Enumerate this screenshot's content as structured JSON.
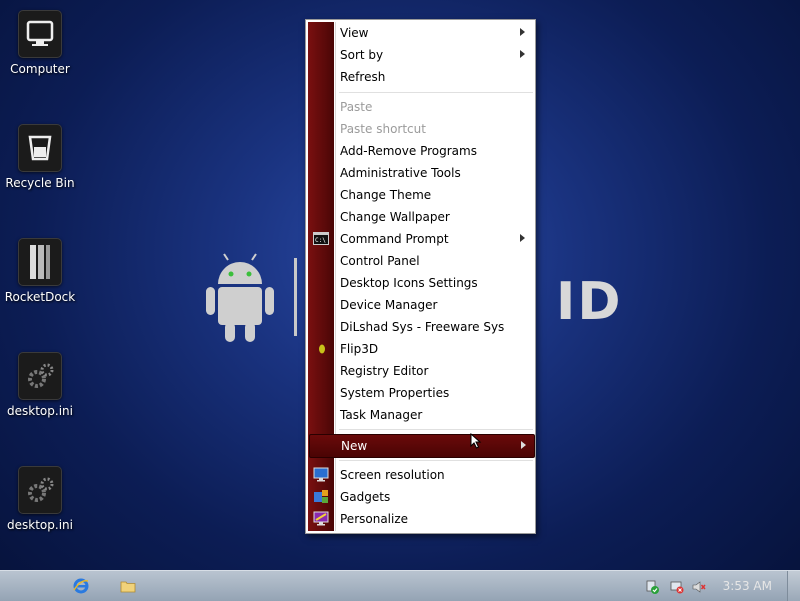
{
  "desktop": {
    "icons": [
      {
        "label": "Computer",
        "icon": "computer-icon"
      },
      {
        "label": "Recycle Bin",
        "icon": "recycle-bin-icon"
      },
      {
        "label": "RocketDock",
        "icon": "rocketdock-icon"
      },
      {
        "label": "desktop.ini",
        "icon": "settings-file-icon"
      },
      {
        "label": "desktop.ini",
        "icon": "settings-file-icon"
      }
    ]
  },
  "wallpaper": {
    "logo_text": "ID"
  },
  "context_menu": {
    "items": [
      {
        "label": "View",
        "submenu": true
      },
      {
        "label": "Sort by",
        "submenu": true
      },
      {
        "label": "Refresh"
      },
      {
        "label": "Paste",
        "disabled": true
      },
      {
        "label": "Paste shortcut",
        "disabled": true
      },
      {
        "label": "Add-Remove Programs"
      },
      {
        "label": "Administrative Tools"
      },
      {
        "label": "Change Theme"
      },
      {
        "label": "Change Wallpaper"
      },
      {
        "label": "Command Prompt",
        "submenu": true,
        "icon": "command-prompt-icon"
      },
      {
        "label": "Control Panel"
      },
      {
        "label": "Desktop Icons Settings"
      },
      {
        "label": "Device Manager"
      },
      {
        "label": "DiLshad Sys - Freeware Sys"
      },
      {
        "label": "Flip3D",
        "icon": "flip3d-icon"
      },
      {
        "label": "Registry Editor"
      },
      {
        "label": "System Properties"
      },
      {
        "label": "Task Manager"
      },
      {
        "label": "New",
        "submenu": true,
        "highlighted": true
      },
      {
        "label": "Screen resolution",
        "icon": "monitor-icon"
      },
      {
        "label": "Gadgets",
        "icon": "gadgets-icon"
      },
      {
        "label": "Personalize",
        "icon": "personalize-icon"
      }
    ]
  },
  "taskbar": {
    "clock": "3:53 AM",
    "quick_launch": [
      "internet-explorer-icon",
      "folder-icon"
    ],
    "tray": [
      "action-center-icon",
      "network-icon",
      "volume-muted-icon"
    ]
  },
  "colors": {
    "menu_accent": "#6a0a0a",
    "desktop_bg": "#1a3380"
  }
}
